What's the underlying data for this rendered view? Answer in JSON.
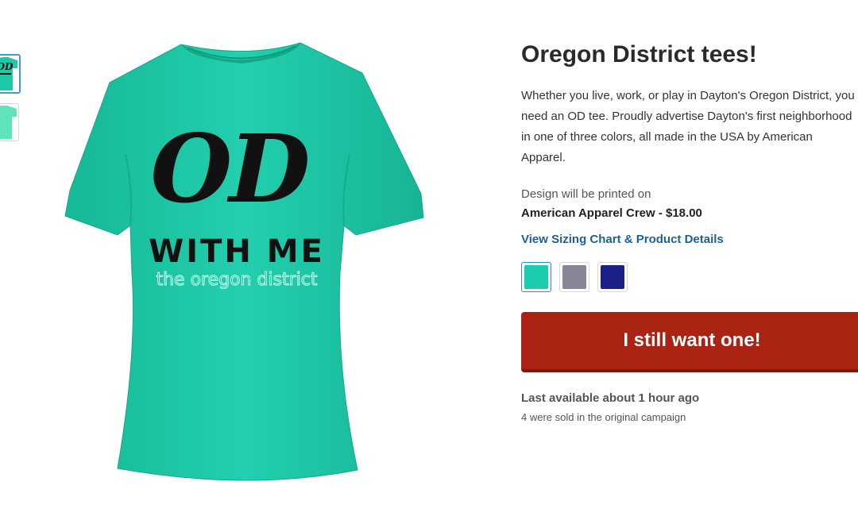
{
  "product": {
    "title": "Oregon District tees!",
    "description": "Whether you live, work, or play in Dayton's Oregon District, you need an OD tee. Proudly advertise Dayton's first neighborhood in one of three colors, all made in the USA by American Apparel.",
    "printed_on_label": "Design will be printed on",
    "product_name": "American Apparel Crew - $18.00",
    "sizing_link": "View Sizing Chart & Product Details",
    "buy_button": "I still want one!",
    "last_available": "Last available about 1 hour ago",
    "sold_count": "4 were sold in the original campaign"
  },
  "shirt_print": {
    "line1": "OD",
    "line2": "WITH ME",
    "line3": "the oregon district"
  },
  "colors": {
    "shirt": "#1fc9a8",
    "swatches": [
      "#1ccdad",
      "#8a8596",
      "#1a1f8a"
    ],
    "buy_button": "#ab2413",
    "link": "#1f5f97"
  },
  "icons": {
    "thumbnail_1": "shirt-front-thumbnail",
    "thumbnail_2": "shirt-alt-thumbnail"
  }
}
